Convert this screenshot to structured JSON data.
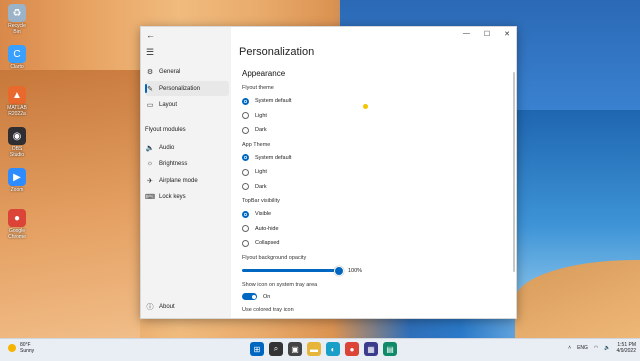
{
  "desktop": {
    "icons": [
      {
        "label": "Recycle Bin",
        "icon": "recycle-bin-icon",
        "glyph": "♻",
        "color": "#9bb3c9"
      },
      {
        "label": "Clarto",
        "icon": "clarto-icon",
        "glyph": "C",
        "color": "#3aa0ff"
      },
      {
        "label": "MATLAB R2022a",
        "icon": "matlab-icon",
        "glyph": "▲",
        "color": "#e8692b"
      },
      {
        "label": "OBS Studio",
        "icon": "obs-icon",
        "glyph": "◉",
        "color": "#302e31"
      },
      {
        "label": "Zoom",
        "icon": "zoom-icon",
        "glyph": "▶",
        "color": "#2d8cff"
      },
      {
        "label": "Google Chrome",
        "icon": "chrome-icon",
        "glyph": "●",
        "color": "#db4437"
      }
    ]
  },
  "window": {
    "title_buttons": {
      "minimize": "—",
      "maximize": "☐",
      "close": "✕"
    },
    "back_glyph": "←",
    "menu_glyph": "☰"
  },
  "sidebar": {
    "items": [
      {
        "label": "General",
        "icon": "gear-icon",
        "glyph": "⚙",
        "active": false
      },
      {
        "label": "Personalization",
        "icon": "brush-icon",
        "glyph": "✎",
        "active": true
      },
      {
        "label": "Layout",
        "icon": "layout-icon",
        "glyph": "▭",
        "active": false
      }
    ],
    "section_title": "Flyout modules",
    "modules": [
      {
        "label": "Audio",
        "icon": "speaker-icon",
        "glyph": "🔈"
      },
      {
        "label": "Brightness",
        "icon": "sun-icon",
        "glyph": "☼"
      },
      {
        "label": "Airplane mode",
        "icon": "airplane-icon",
        "glyph": "✈"
      },
      {
        "label": "Lock keys",
        "icon": "keyboard-icon",
        "glyph": "⌨"
      }
    ],
    "about": {
      "label": "About",
      "icon": "info-icon",
      "glyph": "ⓘ"
    }
  },
  "main": {
    "page_title": "Personalization",
    "section": "Appearance",
    "flyout_theme": {
      "label": "Flyout theme",
      "options": [
        "System default",
        "Light",
        "Dark"
      ],
      "selected": 0
    },
    "app_theme": {
      "label": "App Theme",
      "options": [
        "System default",
        "Light",
        "Dark"
      ],
      "selected": 0
    },
    "topbar_visibility": {
      "label": "TopBar visibility",
      "options": [
        "Visible",
        "Auto-hide",
        "Collapsed"
      ],
      "selected": 0
    },
    "opacity": {
      "label": "Flyout background opacity",
      "value_text": "100%",
      "value": 1.0
    },
    "tray_icon": {
      "label": "Show icon on system tray area",
      "state": "On",
      "on": true
    },
    "colored_tray": {
      "label": "Use colored tray icon"
    }
  },
  "taskbar": {
    "weather": {
      "temp": "80°F",
      "condition": "Sunny"
    },
    "apps": [
      {
        "icon": "start-icon",
        "glyph": "⊞",
        "color": "#0067c0"
      },
      {
        "icon": "search-icon",
        "glyph": "⌕",
        "color": "#333333"
      },
      {
        "icon": "taskview-icon",
        "glyph": "▣",
        "color": "#444444"
      },
      {
        "icon": "file-explorer-icon",
        "glyph": "▬",
        "color": "#e7b53a"
      },
      {
        "icon": "edge-icon",
        "glyph": "◐",
        "color": "#1aa0c8"
      },
      {
        "icon": "chrome-icon",
        "glyph": "●",
        "color": "#db4437"
      },
      {
        "icon": "store-icon",
        "glyph": "▦",
        "color": "#3c3c8c"
      },
      {
        "icon": "app-icon",
        "glyph": "▤",
        "color": "#0f8a6a"
      }
    ],
    "tray": {
      "lang": "ENG",
      "time": "1:51 PM",
      "date": "4/9/2022"
    }
  }
}
